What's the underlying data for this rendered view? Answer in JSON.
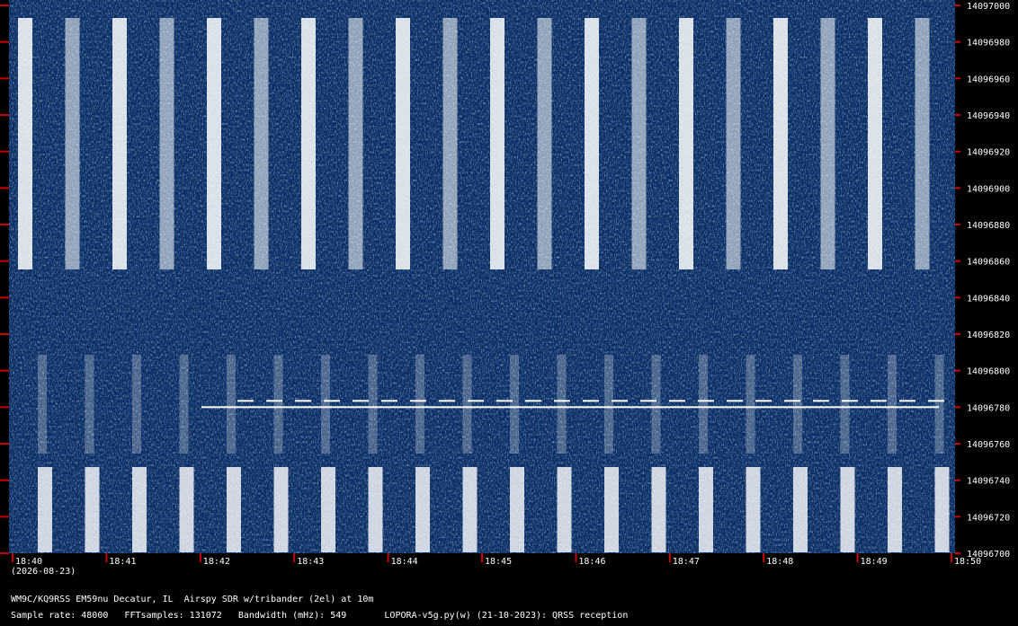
{
  "chart_data": {
    "type": "heatmap",
    "description_kind": "waterfall spectrogram",
    "x_ticks": [
      "18:40",
      "18:41",
      "18:42",
      "18:43",
      "18:44",
      "18:45",
      "18:46",
      "18:47",
      "18:48",
      "18:49",
      "18:50"
    ],
    "x_range_minutes": [
      0,
      10
    ],
    "y_ticks": [
      14097000,
      14096980,
      14096960,
      14096940,
      14096920,
      14096900,
      14096880,
      14096860,
      14096840,
      14096820,
      14096800,
      14096780,
      14096760,
      14096740,
      14096720,
      14096700
    ],
    "y_range_hz": [
      14096700,
      14097000
    ],
    "date_label": "(2026-08-23)",
    "trace_freq_hz": 14096780,
    "colors": {
      "background": "#0a2f66",
      "signal": "#ffffff",
      "tick": "#cc0000"
    }
  },
  "footer": {
    "station": "WM9C/KQ9RSS EM59nu Decatur, IL  Airspy SDR w/tribander (2el) at 10m",
    "params": "Sample rate: 48000   FFTsamples: 131072   Bandwidth (mHz): 549       LOPORA-v5g.py(w) (21-10-2023): QRSS reception"
  }
}
